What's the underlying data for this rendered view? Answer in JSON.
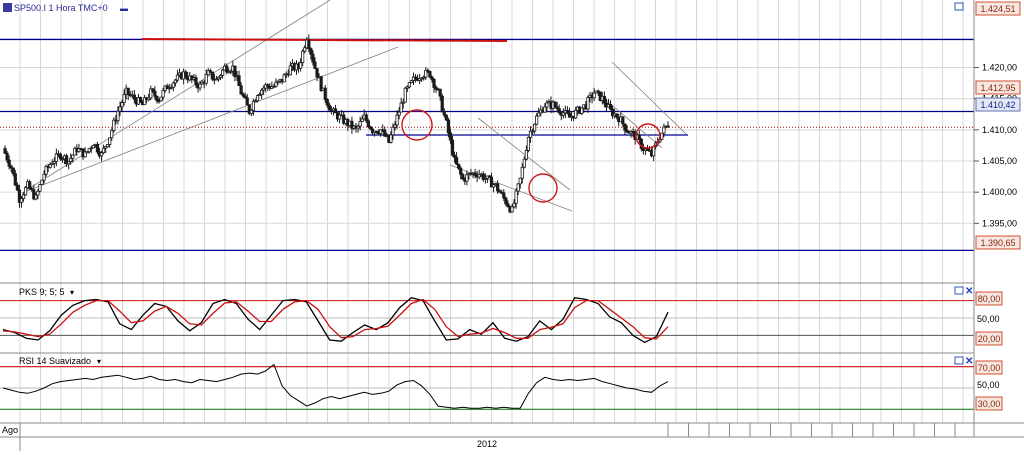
{
  "colors": {
    "candle": "#1a1a1a",
    "support_line": "#00008b",
    "resistance_red": "#cc1010",
    "dotted_price": "#b00000",
    "grid": "#d8d8d8",
    "pks_fast": "#000000",
    "pks_slow": "#cc1010",
    "rsi_line": "#000000",
    "rsi_upper": "#cc1010",
    "rsi_lower": "#208020",
    "circle": "#d01818",
    "tag_red_bg": "#f7e7e0",
    "tag_blue_bg": "#e4e8f6"
  },
  "price_panel": {
    "title": "SP500.I 1 Hora TMC+0",
    "title_separator": "▬",
    "axis_ticks": [
      "1.420,00",
      "1.415,00",
      "1.410,00",
      "1.405,00",
      "1.400,00",
      "1.395,00"
    ],
    "tag_top": "1.424,51",
    "tag_high": "1.412,95",
    "tag_current": "1.410,42",
    "tag_low": "1.390,65"
  },
  "pks_panel": {
    "title": "PKS 9; 5; 5",
    "arrow": "▾",
    "levels": [
      "80,00",
      "50,00",
      "20,00"
    ]
  },
  "rsi_panel": {
    "title": "RSI 14 Suavizado",
    "arrow": "▾",
    "levels": [
      "70,00",
      "50,00",
      "30,00"
    ]
  },
  "time_axis": {
    "start_label": "Ago",
    "year_label": "2012"
  },
  "chart_data": {
    "type": "candlestick",
    "title": "SP500.I 1 Hora TMC+0",
    "ylim": [
      1387,
      1426
    ],
    "y_ticks": [
      1395,
      1400,
      1405,
      1410,
      1415,
      1420
    ],
    "horizontal_levels": [
      1424.51,
      1412.95,
      1410.42,
      1390.65
    ],
    "close_series_approx": [
      1407,
      1404,
      1399,
      1401,
      1399,
      1403,
      1405,
      1406,
      1405,
      1407,
      1406,
      1408,
      1406,
      1409,
      1413,
      1416,
      1415,
      1414,
      1416,
      1415,
      1417,
      1418,
      1419,
      1418,
      1417,
      1419,
      1418,
      1420,
      1420,
      1416,
      1413,
      1416,
      1417,
      1417,
      1418,
      1420,
      1420,
      1425,
      1420,
      1416,
      1413,
      1412,
      1411,
      1410,
      1412,
      1410,
      1410,
      1408,
      1412,
      1416,
      1418,
      1419,
      1419,
      1416,
      1411,
      1405,
      1402,
      1403,
      1403,
      1402,
      1401,
      1399,
      1397,
      1402,
      1409,
      1412,
      1414,
      1414,
      1413,
      1412,
      1413,
      1414,
      1416,
      1415,
      1413,
      1412,
      1410,
      1409,
      1407,
      1406,
      1409,
      1411
    ],
    "pks": {
      "ylim": [
        0,
        100
      ],
      "levels": [
        80,
        50,
        20
      ],
      "series": [
        {
          "values": [
            30,
            25,
            15,
            12,
            28,
            55,
            72,
            80,
            82,
            78,
            40,
            30,
            55,
            75,
            70,
            45,
            28,
            42,
            75,
            82,
            75,
            48,
            30,
            55,
            80,
            82,
            78,
            45,
            12,
            10,
            25,
            38,
            30,
            42,
            68,
            85,
            80,
            45,
            12,
            14,
            30,
            22,
            42,
            15,
            10,
            18,
            45,
            30,
            48,
            85,
            82,
            75,
            52,
            42,
            20,
            8,
            18,
            60
          ]
        },
        {
          "values": [
            28,
            26,
            22,
            18,
            22,
            40,
            60,
            72,
            80,
            80,
            62,
            42,
            45,
            62,
            70,
            58,
            40,
            38,
            58,
            76,
            78,
            62,
            44,
            44,
            65,
            78,
            80,
            65,
            35,
            16,
            18,
            30,
            32,
            36,
            55,
            75,
            82,
            65,
            35,
            18,
            22,
            24,
            32,
            25,
            15,
            15,
            30,
            34,
            40,
            68,
            80,
            80,
            65,
            50,
            35,
            16,
            14,
            35
          ]
        }
      ]
    },
    "rsi": {
      "ylim": [
        20,
        80
      ],
      "levels": [
        70,
        50,
        30
      ],
      "values": [
        50,
        48,
        46,
        45,
        47,
        50,
        54,
        56,
        57,
        58,
        59,
        58,
        60,
        61,
        62,
        60,
        58,
        59,
        61,
        58,
        57,
        58,
        56,
        55,
        58,
        57,
        56,
        58,
        60,
        63,
        64,
        63,
        66,
        72,
        52,
        43,
        38,
        33,
        36,
        40,
        42,
        40,
        42,
        44,
        46,
        44,
        45,
        47,
        53,
        56,
        57,
        52,
        44,
        33,
        32,
        31,
        32,
        31,
        31,
        32,
        31,
        32,
        31,
        31,
        45,
        55,
        60,
        58,
        57,
        58,
        57,
        58,
        59,
        56,
        54,
        52,
        50,
        49,
        47,
        46,
        52,
        56
      ]
    }
  }
}
